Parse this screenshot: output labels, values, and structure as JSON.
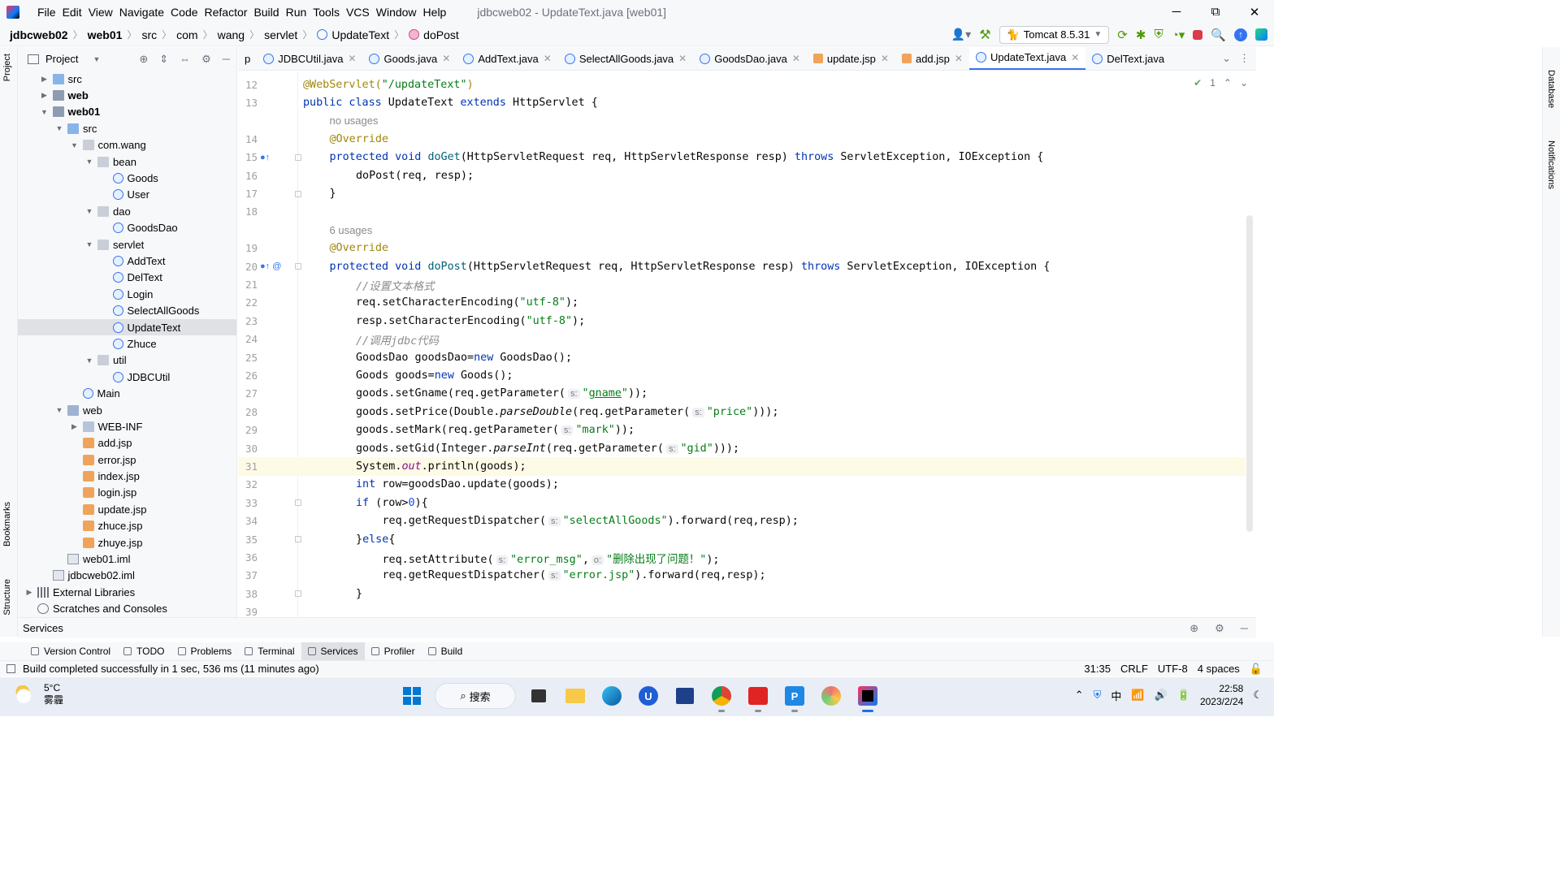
{
  "menubar": {
    "items": [
      "File",
      "Edit",
      "View",
      "Navigate",
      "Code",
      "Refactor",
      "Build",
      "Run",
      "Tools",
      "VCS",
      "Window",
      "Help"
    ],
    "window_title": "jdbcweb02 - UpdateText.java [web01]",
    "minimize": "─",
    "maximize": "⧉",
    "close": "✕"
  },
  "navbar": {
    "crumbs": [
      "jdbcweb02",
      "web01",
      "src",
      "com",
      "wang",
      "servlet",
      "UpdateText",
      "doPost"
    ],
    "run_config": "Tomcat 8.5.31"
  },
  "left_stripe": {
    "project": "Project",
    "bookmarks": "Bookmarks",
    "structure": "Structure"
  },
  "right_stripe": {
    "database": "Database",
    "notifications": "Notifications"
  },
  "project_panel": {
    "title": "Project",
    "tree": [
      {
        "label": "src",
        "depth": 1,
        "arrow": "▶",
        "icon": "srcfolder",
        "bold": false
      },
      {
        "label": "web",
        "depth": 1,
        "arrow": "▶",
        "icon": "modfolder",
        "bold": true
      },
      {
        "label": "web01",
        "depth": 1,
        "arrow": "▼",
        "icon": "modfolder",
        "bold": true
      },
      {
        "label": "src",
        "depth": 2,
        "arrow": "▼",
        "icon": "srcfolder",
        "bold": false
      },
      {
        "label": "com.wang",
        "depth": 3,
        "arrow": "▼",
        "icon": "pkg",
        "bold": false
      },
      {
        "label": "bean",
        "depth": 4,
        "arrow": "▼",
        "icon": "pkg",
        "bold": false
      },
      {
        "label": "Goods",
        "depth": 5,
        "arrow": "",
        "icon": "cls",
        "bold": false
      },
      {
        "label": "User",
        "depth": 5,
        "arrow": "",
        "icon": "cls",
        "bold": false
      },
      {
        "label": "dao",
        "depth": 4,
        "arrow": "▼",
        "icon": "pkg",
        "bold": false
      },
      {
        "label": "GoodsDao",
        "depth": 5,
        "arrow": "",
        "icon": "cls",
        "bold": false
      },
      {
        "label": "servlet",
        "depth": 4,
        "arrow": "▼",
        "icon": "pkg",
        "bold": false
      },
      {
        "label": "AddText",
        "depth": 5,
        "arrow": "",
        "icon": "cls",
        "bold": false
      },
      {
        "label": "DelText",
        "depth": 5,
        "arrow": "",
        "icon": "cls",
        "bold": false
      },
      {
        "label": "Login",
        "depth": 5,
        "arrow": "",
        "icon": "cls",
        "bold": false
      },
      {
        "label": "SelectAllGoods",
        "depth": 5,
        "arrow": "",
        "icon": "cls",
        "bold": false
      },
      {
        "label": "UpdateText",
        "depth": 5,
        "arrow": "",
        "icon": "cls",
        "bold": false,
        "selected": true
      },
      {
        "label": "Zhuce",
        "depth": 5,
        "arrow": "",
        "icon": "cls",
        "bold": false
      },
      {
        "label": "util",
        "depth": 4,
        "arrow": "▼",
        "icon": "pkg",
        "bold": false
      },
      {
        "label": "JDBCUtil",
        "depth": 5,
        "arrow": "",
        "icon": "cls",
        "bold": false
      },
      {
        "label": "Main",
        "depth": 3,
        "arrow": "",
        "icon": "cls",
        "bold": false
      },
      {
        "label": "web",
        "depth": 2,
        "arrow": "▼",
        "icon": "webfolder",
        "bold": false
      },
      {
        "label": "WEB-INF",
        "depth": 3,
        "arrow": "▶",
        "icon": "folder",
        "bold": false
      },
      {
        "label": "add.jsp",
        "depth": 3,
        "arrow": "",
        "icon": "jsp",
        "bold": false
      },
      {
        "label": "error.jsp",
        "depth": 3,
        "arrow": "",
        "icon": "jsp",
        "bold": false
      },
      {
        "label": "index.jsp",
        "depth": 3,
        "arrow": "",
        "icon": "jsp",
        "bold": false
      },
      {
        "label": "login.jsp",
        "depth": 3,
        "arrow": "",
        "icon": "jsp",
        "bold": false
      },
      {
        "label": "update.jsp",
        "depth": 3,
        "arrow": "",
        "icon": "jsp",
        "bold": false
      },
      {
        "label": "zhuce.jsp",
        "depth": 3,
        "arrow": "",
        "icon": "jsp",
        "bold": false
      },
      {
        "label": "zhuye.jsp",
        "depth": 3,
        "arrow": "",
        "icon": "jsp",
        "bold": false
      },
      {
        "label": "web01.iml",
        "depth": 2,
        "arrow": "",
        "icon": "iml",
        "bold": false
      },
      {
        "label": "jdbcweb02.iml",
        "depth": 1,
        "arrow": "",
        "icon": "iml",
        "bold": false
      },
      {
        "label": "External Libraries",
        "depth": 0,
        "arrow": "▶",
        "icon": "lib",
        "bold": false
      },
      {
        "label": "Scratches and Consoles",
        "depth": 0,
        "arrow": "",
        "icon": "scr",
        "bold": false
      }
    ]
  },
  "tabs": [
    {
      "label": "p",
      "icon": "none",
      "closable": false
    },
    {
      "label": "JDBCUtil.java",
      "icon": "cls",
      "closable": true
    },
    {
      "label": "Goods.java",
      "icon": "cls",
      "closable": true
    },
    {
      "label": "AddText.java",
      "icon": "cls",
      "closable": true
    },
    {
      "label": "SelectAllGoods.java",
      "icon": "cls",
      "closable": true
    },
    {
      "label": "GoodsDao.java",
      "icon": "cls",
      "closable": true
    },
    {
      "label": "update.jsp",
      "icon": "jsp",
      "closable": true
    },
    {
      "label": "add.jsp",
      "icon": "jsp",
      "closable": true
    },
    {
      "label": "UpdateText.java",
      "icon": "cls",
      "closable": true,
      "active": true
    },
    {
      "label": "DelText.java",
      "icon": "cls",
      "closable": false
    }
  ],
  "inspection": {
    "count": "1"
  },
  "code_lines": [
    {
      "n": "12",
      "html": "<span class='ann'>@WebServlet(</span><span class='str'>\"/updateText\"</span><span class='ann'>)</span>",
      "indent": 0
    },
    {
      "n": "13",
      "html": "<span class='kw'>public class</span> UpdateText <span class='kw'>extends</span> HttpServlet {",
      "indent": 0
    },
    {
      "n": "",
      "hint": "no usages",
      "indent": 1
    },
    {
      "n": "14",
      "html": "<span class='ann'>@Override</span>",
      "indent": 1
    },
    {
      "n": "15",
      "html": "<span class='kw'>protected void</span> <span style='color:#00627a'>doGet</span>(HttpServletRequest req, HttpServletResponse resp) <span class='kw'>throws</span> ServletException, IOException {",
      "indent": 1,
      "mark": "o↑",
      "fold": true
    },
    {
      "n": "16",
      "html": "doPost(req, resp);",
      "indent": 2
    },
    {
      "n": "17",
      "html": "}",
      "indent": 1,
      "fold": true
    },
    {
      "n": "18",
      "html": "",
      "indent": 0
    },
    {
      "n": "",
      "hint": "6 usages",
      "indent": 1
    },
    {
      "n": "19",
      "html": "<span class='ann'>@Override</span>",
      "indent": 1
    },
    {
      "n": "20",
      "html": "<span class='kw'>protected void</span> <span style='color:#00627a'>doPost</span>(HttpServletRequest req, HttpServletResponse resp) <span class='kw'>throws</span> ServletException, IOException {",
      "indent": 1,
      "mark": "o↑ @",
      "fold": true
    },
    {
      "n": "21",
      "html": "<span class='cm'>//设置文本格式</span>",
      "indent": 2
    },
    {
      "n": "22",
      "html": "req.setCharacterEncoding(<span class='str'>\"utf-8\"</span>);",
      "indent": 2
    },
    {
      "n": "23",
      "html": "resp.setCharacterEncoding(<span class='str'>\"utf-8\"</span>);",
      "indent": 2
    },
    {
      "n": "24",
      "html": "<span class='cm'>//调用jdbc代码</span>",
      "indent": 2
    },
    {
      "n": "25",
      "html": "GoodsDao goodsDao=<span class='kw'>new</span> GoodsDao();",
      "indent": 2
    },
    {
      "n": "26",
      "html": "Goods goods=<span class='kw'>new</span> Goods();",
      "indent": 2
    },
    {
      "n": "27",
      "html": "goods.setGname(req.getParameter(<span class='ph'>s:</span><span class='str'>\"<u>gname</u>\"</span>));",
      "indent": 2
    },
    {
      "n": "28",
      "html": "goods.setPrice(Double.<span class='it'>parseDouble</span>(req.getParameter(<span class='ph'>s:</span><span class='str'>\"price\"</span>)));",
      "indent": 2
    },
    {
      "n": "29",
      "html": "goods.setMark(req.getParameter(<span class='ph'>s:</span><span class='str'>\"mark\"</span>));",
      "indent": 2
    },
    {
      "n": "30",
      "html": "goods.setGid(Integer.<span class='it'>parseInt</span>(req.getParameter(<span class='ph'>s:</span><span class='str'>\"gid\"</span>)));",
      "indent": 2
    },
    {
      "n": "31",
      "html": "System.<span class='fld'>out</span>.println(goods);",
      "indent": 2,
      "current": true
    },
    {
      "n": "32",
      "html": "<span class='kw'>int</span> row=goodsDao.update(goods);",
      "indent": 2
    },
    {
      "n": "33",
      "html": "<span class='kw'>if</span> (row><span class='num'>0</span>){",
      "indent": 2,
      "fold": true
    },
    {
      "n": "34",
      "html": "req.getRequestDispatcher(<span class='ph'>s:</span><span class='str'>\"selectAllGoods\"</span>).forward(req,resp);",
      "indent": 3
    },
    {
      "n": "35",
      "html": "}<span class='kw'>else</span>{",
      "indent": 2,
      "fold": true
    },
    {
      "n": "36",
      "html": "req.setAttribute(<span class='ph'>s:</span><span class='str'>\"error_msg\"</span>,<span class='ph'>o:</span><span class='str'>\"删除出现了问题！\"</span>);",
      "indent": 3
    },
    {
      "n": "37",
      "html": "req.getRequestDispatcher(<span class='ph'>s:</span><span class='str'>\"error.jsp\"</span>).forward(req,resp);",
      "indent": 3
    },
    {
      "n": "38",
      "html": "}",
      "indent": 2,
      "fold": true
    },
    {
      "n": "39",
      "html": "",
      "indent": 0
    }
  ],
  "services_panel": {
    "title": "Services"
  },
  "bottom_tabs": [
    {
      "label": "Version Control"
    },
    {
      "label": "TODO"
    },
    {
      "label": "Problems"
    },
    {
      "label": "Terminal"
    },
    {
      "label": "Services",
      "active": true
    },
    {
      "label": "Profiler"
    },
    {
      "label": "Build"
    }
  ],
  "status": {
    "message": "Build completed successfully in 1 sec, 536 ms (11 minutes ago)",
    "position": "31:35",
    "line_sep": "CRLF",
    "encoding": "UTF-8",
    "indent": "4 spaces"
  },
  "taskbar": {
    "temp": "5°C",
    "weather": "雾霾",
    "search": "搜索",
    "ime": "中",
    "time": "22:58",
    "date": "2023/2/24"
  },
  "colors": {
    "accent": "#3574f0",
    "keyword": "#0033b3",
    "string": "#067d17",
    "annotation": "#9e880d"
  }
}
